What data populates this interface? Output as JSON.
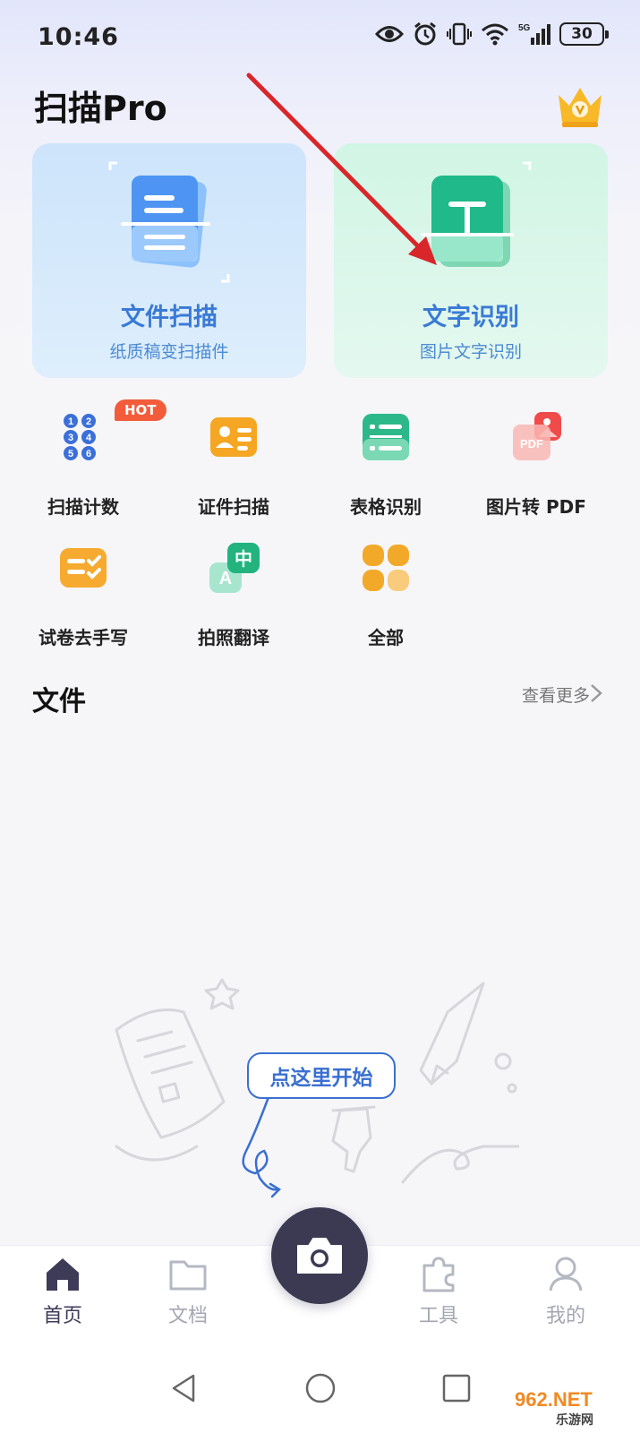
{
  "status_bar": {
    "time": "10:46",
    "battery": "30",
    "network": "5G"
  },
  "header": {
    "app_title": "扫描Pro",
    "vip_icon": "crown-vip-icon"
  },
  "feature_cards": [
    {
      "title": "文件扫描",
      "subtitle": "纸质稿变扫描件",
      "icon": "document-scan-icon"
    },
    {
      "title": "文字识别",
      "subtitle": "图片文字识别",
      "icon": "text-recognition-icon"
    }
  ],
  "tools": [
    {
      "label": "扫描计数",
      "icon": "count-icon",
      "badge": "HOT",
      "digits": [
        "1",
        "2",
        "3",
        "4",
        "5",
        "6"
      ]
    },
    {
      "label": "证件扫描",
      "icon": "id-card-icon"
    },
    {
      "label": "表格识别",
      "icon": "table-icon"
    },
    {
      "label": "图片转 PDF",
      "icon": "image-to-pdf-icon",
      "glyph": "PDF"
    },
    {
      "label": "试卷去手写",
      "icon": "remove-handwriting-icon"
    },
    {
      "label": "拍照翻译",
      "icon": "translate-icon",
      "glyphs": [
        "A",
        "中"
      ]
    },
    {
      "label": "全部",
      "icon": "all-apps-icon"
    }
  ],
  "files": {
    "title": "文件",
    "more_label": "查看更多"
  },
  "empty_state": {
    "hint": "点这里开始"
  },
  "bottom_nav": {
    "items": [
      {
        "label": "首页",
        "icon": "home-icon",
        "active": true
      },
      {
        "label": "文档",
        "icon": "folder-icon",
        "active": false
      },
      {
        "label": "工具",
        "icon": "puzzle-icon",
        "active": false
      },
      {
        "label": "我的",
        "icon": "profile-icon",
        "active": false
      }
    ],
    "camera_icon": "camera-icon"
  },
  "watermark": {
    "line1": "962.NET",
    "line2": "乐游网"
  },
  "colors": {
    "accent_blue": "#3a7ad6",
    "accent_green": "#1fb98a",
    "hot_badge": "#f25c3a",
    "nav_active": "#3d3b58",
    "camera_button": "#3b3a52"
  }
}
